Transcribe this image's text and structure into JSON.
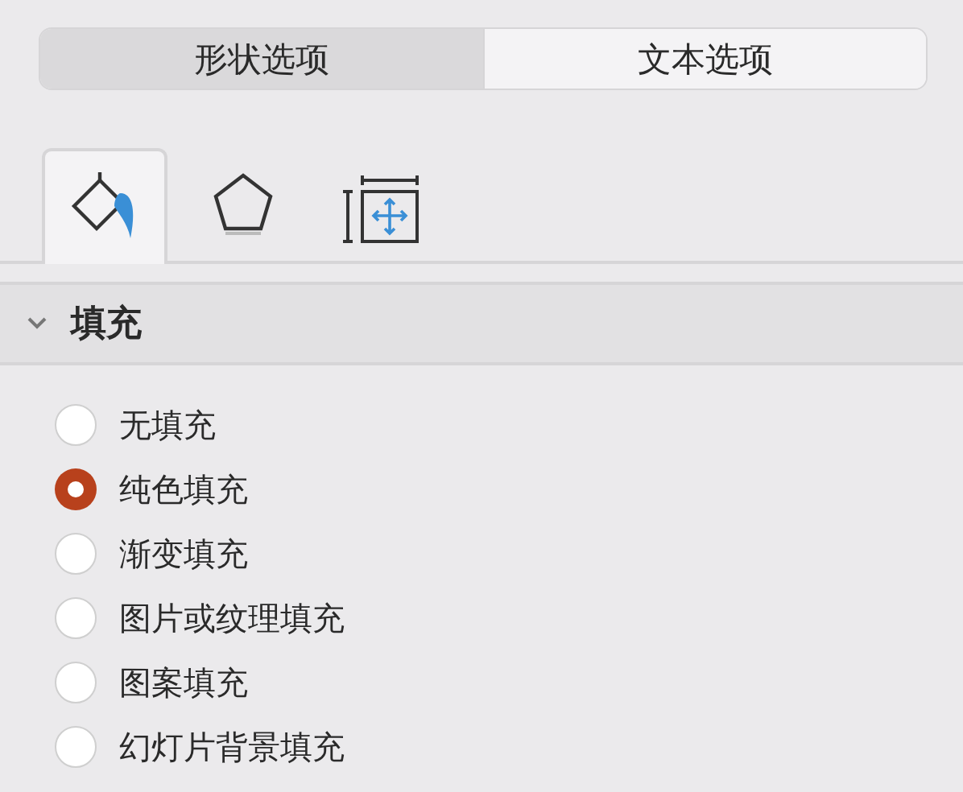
{
  "option_tabs": [
    {
      "label": "形状选项",
      "selected": true
    },
    {
      "label": "文本选项",
      "selected": false
    }
  ],
  "icon_tabs": [
    {
      "kind": "fill",
      "selected": true
    },
    {
      "kind": "shape",
      "selected": false
    },
    {
      "kind": "size",
      "selected": false
    }
  ],
  "section": {
    "title": "填充",
    "expanded": true
  },
  "fill_options": [
    {
      "label": "无填充",
      "selected": false
    },
    {
      "label": "纯色填充",
      "selected": true
    },
    {
      "label": "渐变填充",
      "selected": false
    },
    {
      "label": "图片或纹理填充",
      "selected": false
    },
    {
      "label": "图案填充",
      "selected": false
    },
    {
      "label": "幻灯片背景填充",
      "selected": false
    }
  ]
}
